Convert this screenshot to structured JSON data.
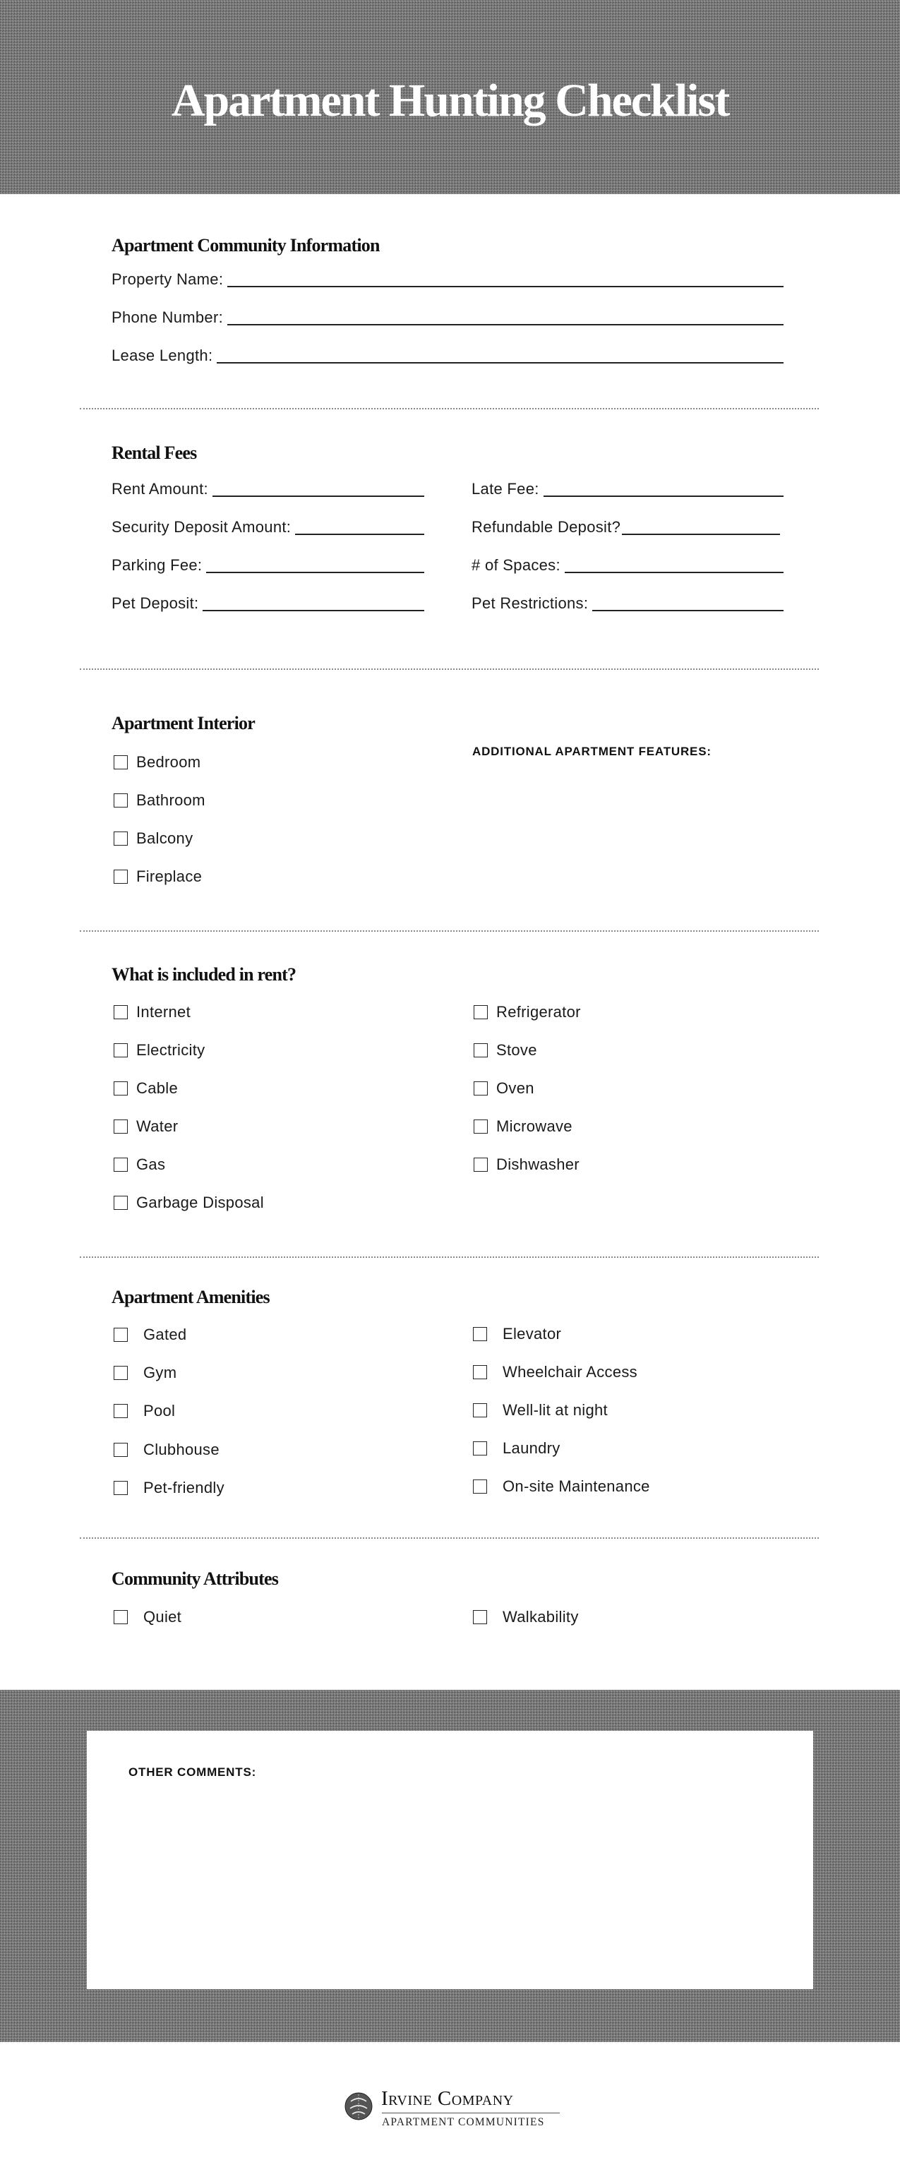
{
  "header": {
    "title": "Apartment Hunting Checklist"
  },
  "community_info": {
    "heading": "Apartment Community Information",
    "fields": [
      {
        "label": "Property Name:",
        "value": ""
      },
      {
        "label": "Phone Number:",
        "value": ""
      },
      {
        "label": "Lease Length:",
        "value": ""
      }
    ]
  },
  "rental_fees": {
    "heading": "Rental Fees",
    "left": [
      {
        "label": "Rent Amount:",
        "value": ""
      },
      {
        "label": "Security Deposit Amount:",
        "value": ""
      },
      {
        "label": "Parking Fee:",
        "value": ""
      },
      {
        "label": "Pet Deposit:",
        "value": ""
      }
    ],
    "right": [
      {
        "label": "Late Fee:",
        "value": ""
      },
      {
        "label": "Refundable Deposit?",
        "value": ""
      },
      {
        "label": "# of Spaces:",
        "value": ""
      },
      {
        "label": "Pet Restrictions:",
        "value": ""
      }
    ]
  },
  "interior": {
    "heading": "Apartment Interior",
    "items": [
      {
        "label": "Bedroom",
        "checked": false
      },
      {
        "label": "Bathroom",
        "checked": false
      },
      {
        "label": "Balcony",
        "checked": false
      },
      {
        "label": "Fireplace",
        "checked": false
      }
    ],
    "additional_features_label": "ADDITIONAL APARTMENT FEATURES:"
  },
  "included_in_rent": {
    "heading": "What is included in rent?",
    "left": [
      {
        "label": "Internet",
        "checked": false
      },
      {
        "label": "Electricity",
        "checked": false
      },
      {
        "label": "Cable",
        "checked": false
      },
      {
        "label": "Water",
        "checked": false
      },
      {
        "label": "Gas",
        "checked": false
      },
      {
        "label": "Garbage Disposal",
        "checked": false
      }
    ],
    "right": [
      {
        "label": "Refrigerator",
        "checked": false
      },
      {
        "label": "Stove",
        "checked": false
      },
      {
        "label": "Oven",
        "checked": false
      },
      {
        "label": "Microwave",
        "checked": false
      },
      {
        "label": "Dishwasher",
        "checked": false
      }
    ]
  },
  "amenities": {
    "heading": "Apartment Amenities",
    "left": [
      {
        "label": "Gated",
        "checked": false
      },
      {
        "label": "Gym",
        "checked": false
      },
      {
        "label": "Pool",
        "checked": false
      },
      {
        "label": "Clubhouse",
        "checked": false
      },
      {
        "label": "Pet-friendly",
        "checked": false
      }
    ],
    "right": [
      {
        "label": "Elevator",
        "checked": false
      },
      {
        "label": "Wheelchair Access",
        "checked": false
      },
      {
        "label": "Well-lit at night",
        "checked": false
      },
      {
        "label": "Laundry",
        "checked": false
      },
      {
        "label": "On-site Maintenance",
        "checked": false
      }
    ]
  },
  "community_attributes": {
    "heading": "Community Attributes",
    "left": [
      {
        "label": "Quiet",
        "checked": false
      }
    ],
    "right": [
      {
        "label": "Walkability",
        "checked": false
      }
    ]
  },
  "comments": {
    "label": "OTHER COMMENTS:",
    "value": ""
  },
  "footer": {
    "logo_icon": "irvine-company-emblem-icon",
    "brand_name": "Irvine Company",
    "brand_subtitle": "APARTMENT COMMUNITIES"
  },
  "colors": {
    "band_gray": "#7b7b7b",
    "text": "#111111",
    "background": "#ffffff"
  }
}
